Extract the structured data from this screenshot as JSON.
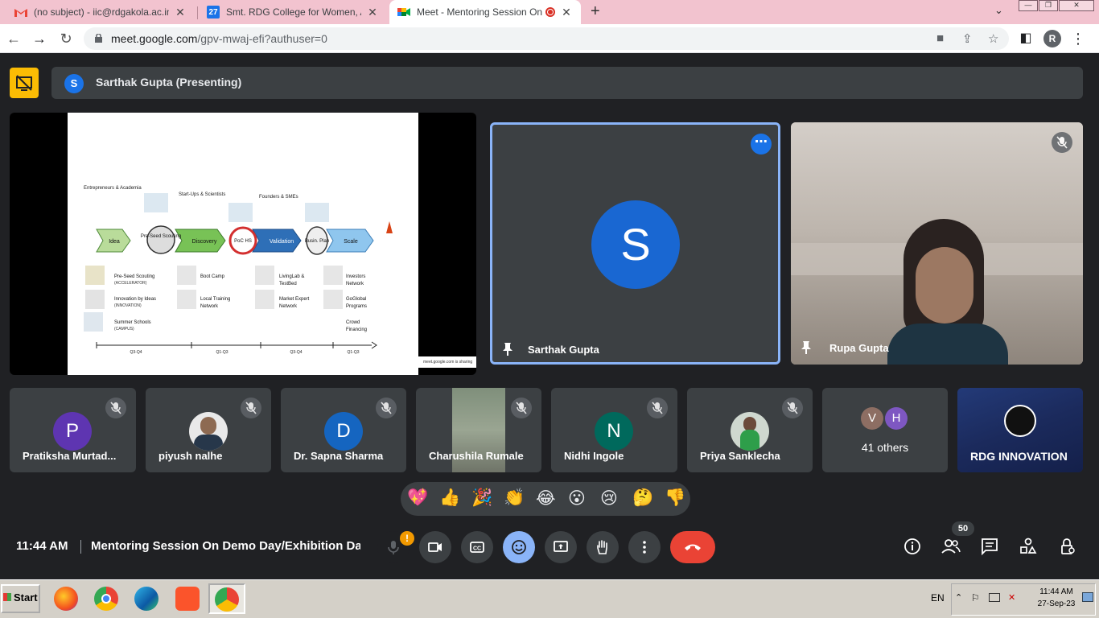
{
  "browser": {
    "tabs": [
      {
        "title": "(no subject) - iic@rdgakola.ac.in - S",
        "icon": "gmail-icon",
        "close": "✕"
      },
      {
        "title": "Smt. RDG College for Women, Akola",
        "icon": "calendar-icon",
        "favtext": "27",
        "close": "✕"
      },
      {
        "title": "Meet - Mentoring Session On D",
        "icon": "meet-icon",
        "close": "✕"
      }
    ],
    "new_tab": "+",
    "url_host": "meet.google.com",
    "url_path": "/gpv-mwaj-efi?authuser=0",
    "profile_initial": "R"
  },
  "presentation": {
    "avatar_initial": "S",
    "title": "Sarthak Gupta (Presenting)"
  },
  "slide": {
    "stage_labels": [
      "Idea",
      "Pre-Seed Scouting",
      "Discovery",
      "PoC HS",
      "Validation",
      "Busin. Plan",
      "Scale"
    ],
    "top_labels": [
      "Entrepreneurs & Academia",
      "Start-Ups & Scientists",
      "Founders & SMEs"
    ],
    "col1": [
      "Pre-Seed Scouting",
      "(ACCELERATOR)",
      "Innovation by Ideas",
      "(INNOVATION)",
      "Summer Schools",
      "(CAMPUS)"
    ],
    "col2": [
      "Boot Camp",
      "Local Training",
      "Network"
    ],
    "col3": [
      "LivingLab &",
      "TestBed",
      "Market Expert",
      "Network"
    ],
    "col4": [
      "Investors",
      "Network",
      "GoGlobal",
      "Programs",
      "Crowd",
      "Financing"
    ],
    "timeline": [
      "Q3-Q4",
      "Q1-Q3",
      "Q3-Q4",
      "Q1-Q3"
    ],
    "share_note": "meet.google.com is sharing"
  },
  "main_tiles": [
    {
      "name": "Sarthak Gupta",
      "initial": "S"
    },
    {
      "name": "Rupa Gupta"
    }
  ],
  "participants": [
    {
      "name": "Pratiksha Murtad...",
      "initial": "P",
      "color": "#5e35b1"
    },
    {
      "name": "piyush nalhe"
    },
    {
      "name": "Dr. Sapna Sharma",
      "initial": "D",
      "color": "#1565c0"
    },
    {
      "name": "Charushila Rumale"
    },
    {
      "name": "Nidhi Ingole",
      "initial": "N",
      "color": "#00695c"
    },
    {
      "name": "Priya Sanklecha"
    }
  ],
  "others": {
    "initials": [
      "V",
      "H"
    ],
    "label": "41 others"
  },
  "rdg_tile": {
    "name": "RDG INNOVATION"
  },
  "reactions": [
    "💖",
    "👍",
    "🎉",
    "👏",
    "😂",
    "😮",
    "😢",
    "🤔",
    "👎"
  ],
  "meeting": {
    "time": "11:44 AM",
    "title": "Mentoring Session On Demo Day/Exhibition Day",
    "mic_alert": "!",
    "people_count": "50"
  },
  "taskbar": {
    "start_label": "Start",
    "lang": "EN",
    "time": "11:44 AM",
    "date": "27-Sep-23"
  }
}
